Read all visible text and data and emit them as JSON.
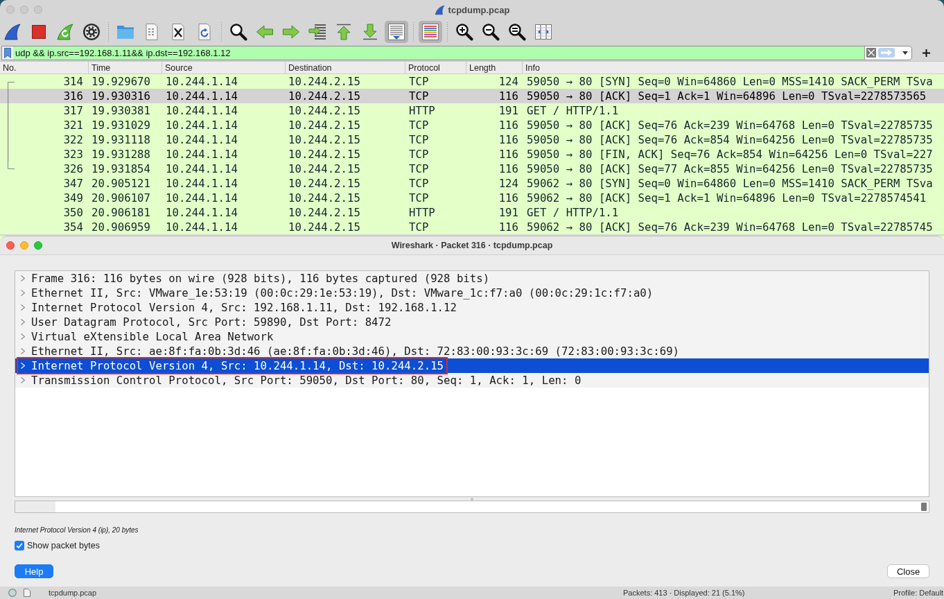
{
  "window": {
    "title": "tcpdump.pcap",
    "active": false
  },
  "toolbar": {
    "groups": [
      [
        {
          "kind": "start",
          "pressed": false
        },
        {
          "kind": "stop",
          "pressed": false
        },
        {
          "kind": "restart",
          "pressed": false
        },
        {
          "kind": "options",
          "pressed": false
        }
      ],
      [
        {
          "kind": "open",
          "pressed": false
        },
        {
          "kind": "file",
          "pressed": false
        },
        {
          "kind": "close",
          "pressed": false
        },
        {
          "kind": "reload",
          "pressed": false
        }
      ],
      [
        {
          "kind": "find",
          "pressed": false
        },
        {
          "kind": "back",
          "pressed": false
        },
        {
          "kind": "forward",
          "pressed": false
        },
        {
          "kind": "goto",
          "pressed": false
        },
        {
          "kind": "first",
          "pressed": false
        },
        {
          "kind": "last",
          "pressed": false
        },
        {
          "kind": "autoscroll",
          "pressed": true
        }
      ],
      [
        {
          "kind": "colorize",
          "pressed": true
        }
      ],
      [
        {
          "kind": "zoomin",
          "pressed": false
        },
        {
          "kind": "zoomout",
          "pressed": false
        },
        {
          "kind": "zoomreset",
          "pressed": false
        },
        {
          "kind": "resize",
          "pressed": false
        }
      ]
    ]
  },
  "filter": {
    "value": "udp && ip.src==192.168.1.11&& ip.dst==192.168.1.12",
    "valid": true
  },
  "packet_list": {
    "columns": [
      "No.",
      "Time",
      "Source",
      "Destination",
      "Protocol",
      "Length",
      "Info"
    ],
    "rows": [
      {
        "no": "314",
        "time": "19.929670",
        "source": "10.244.1.14",
        "destination": "10.244.2.15",
        "protocol": "TCP",
        "length": "124",
        "info": "59050 → 80 [SYN] Seq=0 Win=64860 Len=0 MSS=1410 SACK_PERM TSva",
        "selected": false,
        "related": true
      },
      {
        "no": "316",
        "time": "19.930316",
        "source": "10.244.1.14",
        "destination": "10.244.2.15",
        "protocol": "TCP",
        "length": "116",
        "info": "59050 → 80 [ACK] Seq=1 Ack=1 Win=64896 Len=0 TSval=2278573565",
        "selected": true,
        "related": true
      },
      {
        "no": "317",
        "time": "19.930381",
        "source": "10.244.1.14",
        "destination": "10.244.2.15",
        "protocol": "HTTP",
        "length": "191",
        "info": "GET / HTTP/1.1",
        "selected": false,
        "related": true
      },
      {
        "no": "321",
        "time": "19.931029",
        "source": "10.244.1.14",
        "destination": "10.244.2.15",
        "protocol": "TCP",
        "length": "116",
        "info": "59050 → 80 [ACK] Seq=76 Ack=239 Win=64768 Len=0 TSval=22785735",
        "selected": false,
        "related": true
      },
      {
        "no": "322",
        "time": "19.931118",
        "source": "10.244.1.14",
        "destination": "10.244.2.15",
        "protocol": "TCP",
        "length": "116",
        "info": "59050 → 80 [ACK] Seq=76 Ack=854 Win=64256 Len=0 TSval=22785735",
        "selected": false,
        "related": true
      },
      {
        "no": "323",
        "time": "19.931288",
        "source": "10.244.1.14",
        "destination": "10.244.2.15",
        "protocol": "TCP",
        "length": "116",
        "info": "59050 → 80 [FIN, ACK] Seq=76 Ack=854 Win=64256 Len=0 TSval=227",
        "selected": false,
        "related": true
      },
      {
        "no": "326",
        "time": "19.931854",
        "source": "10.244.1.14",
        "destination": "10.244.2.15",
        "protocol": "TCP",
        "length": "116",
        "info": "59050 → 80 [ACK] Seq=77 Ack=855 Win=64256 Len=0 TSval=22785735",
        "selected": false,
        "related": true
      },
      {
        "no": "347",
        "time": "20.905121",
        "source": "10.244.1.14",
        "destination": "10.244.2.15",
        "protocol": "TCP",
        "length": "124",
        "info": "59062 → 80 [SYN] Seq=0 Win=64860 Len=0 MSS=1410 SACK_PERM TSva",
        "selected": false,
        "related": false
      },
      {
        "no": "349",
        "time": "20.906107",
        "source": "10.244.1.14",
        "destination": "10.244.2.15",
        "protocol": "TCP",
        "length": "116",
        "info": "59062 → 80 [ACK] Seq=1 Ack=1 Win=64896 Len=0 TSval=2278574541",
        "selected": false,
        "related": false
      },
      {
        "no": "350",
        "time": "20.906181",
        "source": "10.244.1.14",
        "destination": "10.244.2.15",
        "protocol": "HTTP",
        "length": "191",
        "info": "GET / HTTP/1.1",
        "selected": false,
        "related": false
      },
      {
        "no": "354",
        "time": "20.906959",
        "source": "10.244.1.14",
        "destination": "10.244.2.15",
        "protocol": "TCP",
        "length": "116",
        "info": "59062 → 80 [ACK] Seq=76 Ack=239 Win=64768 Len=0 TSval=22785745",
        "selected": false,
        "related": false
      }
    ]
  },
  "dialog": {
    "title": "Wireshark · Packet 316 · tcpdump.pcap",
    "active": true,
    "tree": [
      {
        "label": "Frame 316: 116 bytes on wire (928 bits), 116 bytes captured (928 bits)",
        "expanded": false,
        "selected": false,
        "annotated": false
      },
      {
        "label": "Ethernet II, Src: VMware_1e:53:19 (00:0c:29:1e:53:19), Dst: VMware_1c:f7:a0 (00:0c:29:1c:f7:a0)",
        "expanded": false,
        "selected": false,
        "annotated": false
      },
      {
        "label": "Internet Protocol Version 4, Src: 192.168.1.11, Dst: 192.168.1.12",
        "expanded": false,
        "selected": false,
        "annotated": false
      },
      {
        "label": "User Datagram Protocol, Src Port: 59890, Dst Port: 8472",
        "expanded": false,
        "selected": false,
        "annotated": false
      },
      {
        "label": "Virtual eXtensible Local Area Network",
        "expanded": false,
        "selected": false,
        "annotated": false
      },
      {
        "label": "Ethernet II, Src: ae:8f:fa:0b:3d:46 (ae:8f:fa:0b:3d:46), Dst: 72:83:00:93:3c:69 (72:83:00:93:3c:69)",
        "expanded": false,
        "selected": false,
        "annotated": false
      },
      {
        "label": "Internet Protocol Version 4, Src: 10.244.1.14, Dst: 10.244.2.15",
        "expanded": false,
        "selected": true,
        "annotated": true
      },
      {
        "label": "Transmission Control Protocol, Src Port: 59050, Dst Port: 80, Seq: 1, Ack: 1, Len: 0",
        "expanded": false,
        "selected": false,
        "annotated": false
      }
    ],
    "status": "Internet Protocol Version 4 (ip), 20 bytes",
    "show_bytes": {
      "label": "Show packet bytes",
      "checked": true
    },
    "buttons": [
      {
        "label": "Help",
        "default": true
      },
      {
        "label": "Close",
        "default": false
      }
    ]
  },
  "status_bar": {
    "file": "tcpdump.pcap",
    "packets": "Packets: 413 · Displayed: 21 (5.1%)",
    "profile": "Profile: Default"
  }
}
